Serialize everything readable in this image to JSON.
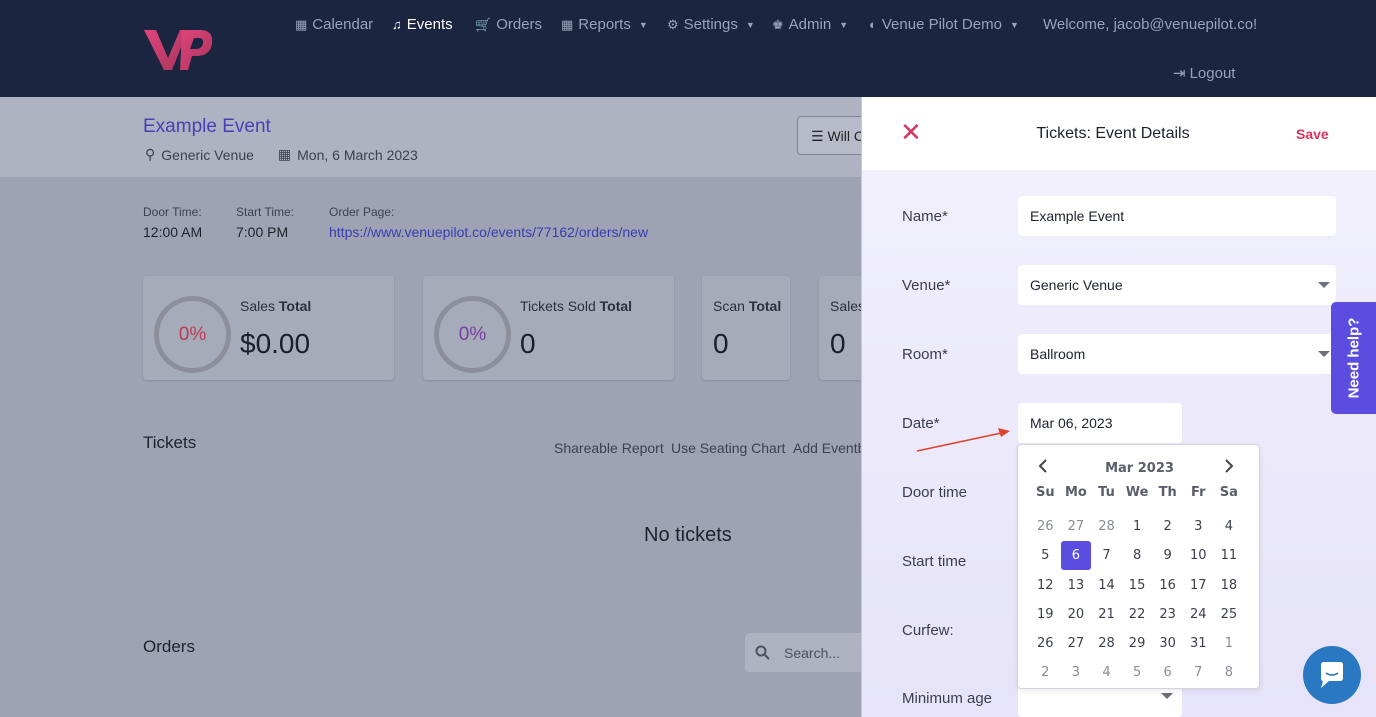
{
  "nav": {
    "items": [
      {
        "label": "Calendar",
        "icon": "calendar-icon",
        "has_caret": false
      },
      {
        "label": "Events",
        "icon": "music-note-icon",
        "has_caret": false,
        "active": true
      },
      {
        "label": "Orders",
        "icon": "cart-icon",
        "has_caret": false
      },
      {
        "label": "Reports",
        "icon": "grid-icon",
        "has_caret": true
      },
      {
        "label": "Settings",
        "icon": "gear-icon",
        "has_caret": true
      },
      {
        "label": "Admin",
        "icon": "chess-king-icon",
        "has_caret": true
      },
      {
        "label": "Venue Pilot Demo",
        "icon": "half-circle-icon",
        "has_caret": true
      }
    ],
    "welcome": "Welcome, jacob@venuepilot.co!",
    "logout": "Logout"
  },
  "event": {
    "title": "Example Event",
    "venue": "Generic Venue",
    "date": "Mon, 6 March 2023",
    "will_call_label": "Will C",
    "door_time_label": "Door Time:",
    "door_time": "12:00 AM",
    "start_time_label": "Start Time:",
    "start_time": "7:00 PM",
    "order_page_label": "Order Page:",
    "order_page_url": "https://www.venuepilot.co/events/77162/orders/new"
  },
  "stats": [
    {
      "percent": "0%",
      "label": "Sales",
      "label_bold": "Total",
      "value": "$0.00",
      "ring_color": "#c0394f"
    },
    {
      "percent": "0%",
      "label": "Tickets Sold",
      "label_bold": "Total",
      "value": "0",
      "ring_color": "#7a3fa0"
    },
    {
      "label": "Scan",
      "label_bold": "Total",
      "value": "0"
    },
    {
      "label": "Sales",
      "value": "0"
    }
  ],
  "tickets": {
    "title": "Tickets",
    "actions": [
      "Shareable Report",
      "Use Seating Chart",
      "Add Eventb"
    ],
    "empty": "No tickets"
  },
  "orders": {
    "title": "Orders",
    "search_placeholder": "Search..."
  },
  "panel": {
    "title": "Tickets: Event Details",
    "save": "Save",
    "fields": {
      "name_label": "Name*",
      "name_value": "Example Event",
      "venue_label": "Venue*",
      "venue_value": "Generic Venue",
      "room_label": "Room*",
      "room_value": "Ballroom",
      "date_label": "Date*",
      "date_value": "Mar 06, 2023",
      "door_label": "Door time",
      "start_label": "Start time",
      "curfew_label": "Curfew:",
      "min_age_label": "Minimum age"
    }
  },
  "calendar": {
    "month_label": "Mar 2023",
    "weekdays": [
      "Su",
      "Mo",
      "Tu",
      "We",
      "Th",
      "Fr",
      "Sa"
    ],
    "days": [
      {
        "d": "26",
        "muted": true
      },
      {
        "d": "27",
        "muted": true
      },
      {
        "d": "28",
        "muted": true
      },
      {
        "d": "1"
      },
      {
        "d": "2"
      },
      {
        "d": "3"
      },
      {
        "d": "4"
      },
      {
        "d": "5"
      },
      {
        "d": "6",
        "selected": true
      },
      {
        "d": "7"
      },
      {
        "d": "8"
      },
      {
        "d": "9"
      },
      {
        "d": "10"
      },
      {
        "d": "11"
      },
      {
        "d": "12"
      },
      {
        "d": "13"
      },
      {
        "d": "14"
      },
      {
        "d": "15"
      },
      {
        "d": "16"
      },
      {
        "d": "17"
      },
      {
        "d": "18"
      },
      {
        "d": "19"
      },
      {
        "d": "20"
      },
      {
        "d": "21"
      },
      {
        "d": "22"
      },
      {
        "d": "23"
      },
      {
        "d": "24"
      },
      {
        "d": "25"
      },
      {
        "d": "26"
      },
      {
        "d": "27"
      },
      {
        "d": "28"
      },
      {
        "d": "29"
      },
      {
        "d": "30"
      },
      {
        "d": "31"
      },
      {
        "d": "1",
        "muted": true
      },
      {
        "d": "2",
        "muted": true
      },
      {
        "d": "3",
        "muted": true
      },
      {
        "d": "4",
        "muted": true
      },
      {
        "d": "5",
        "muted": true
      },
      {
        "d": "6",
        "muted": true
      },
      {
        "d": "7",
        "muted": true
      },
      {
        "d": "8",
        "muted": true
      }
    ]
  },
  "help": {
    "label": "Need help?"
  },
  "colors": {
    "accent": "#5b4de0",
    "brand_pink": "#d8345f",
    "nav_bg": "#1b2540"
  }
}
